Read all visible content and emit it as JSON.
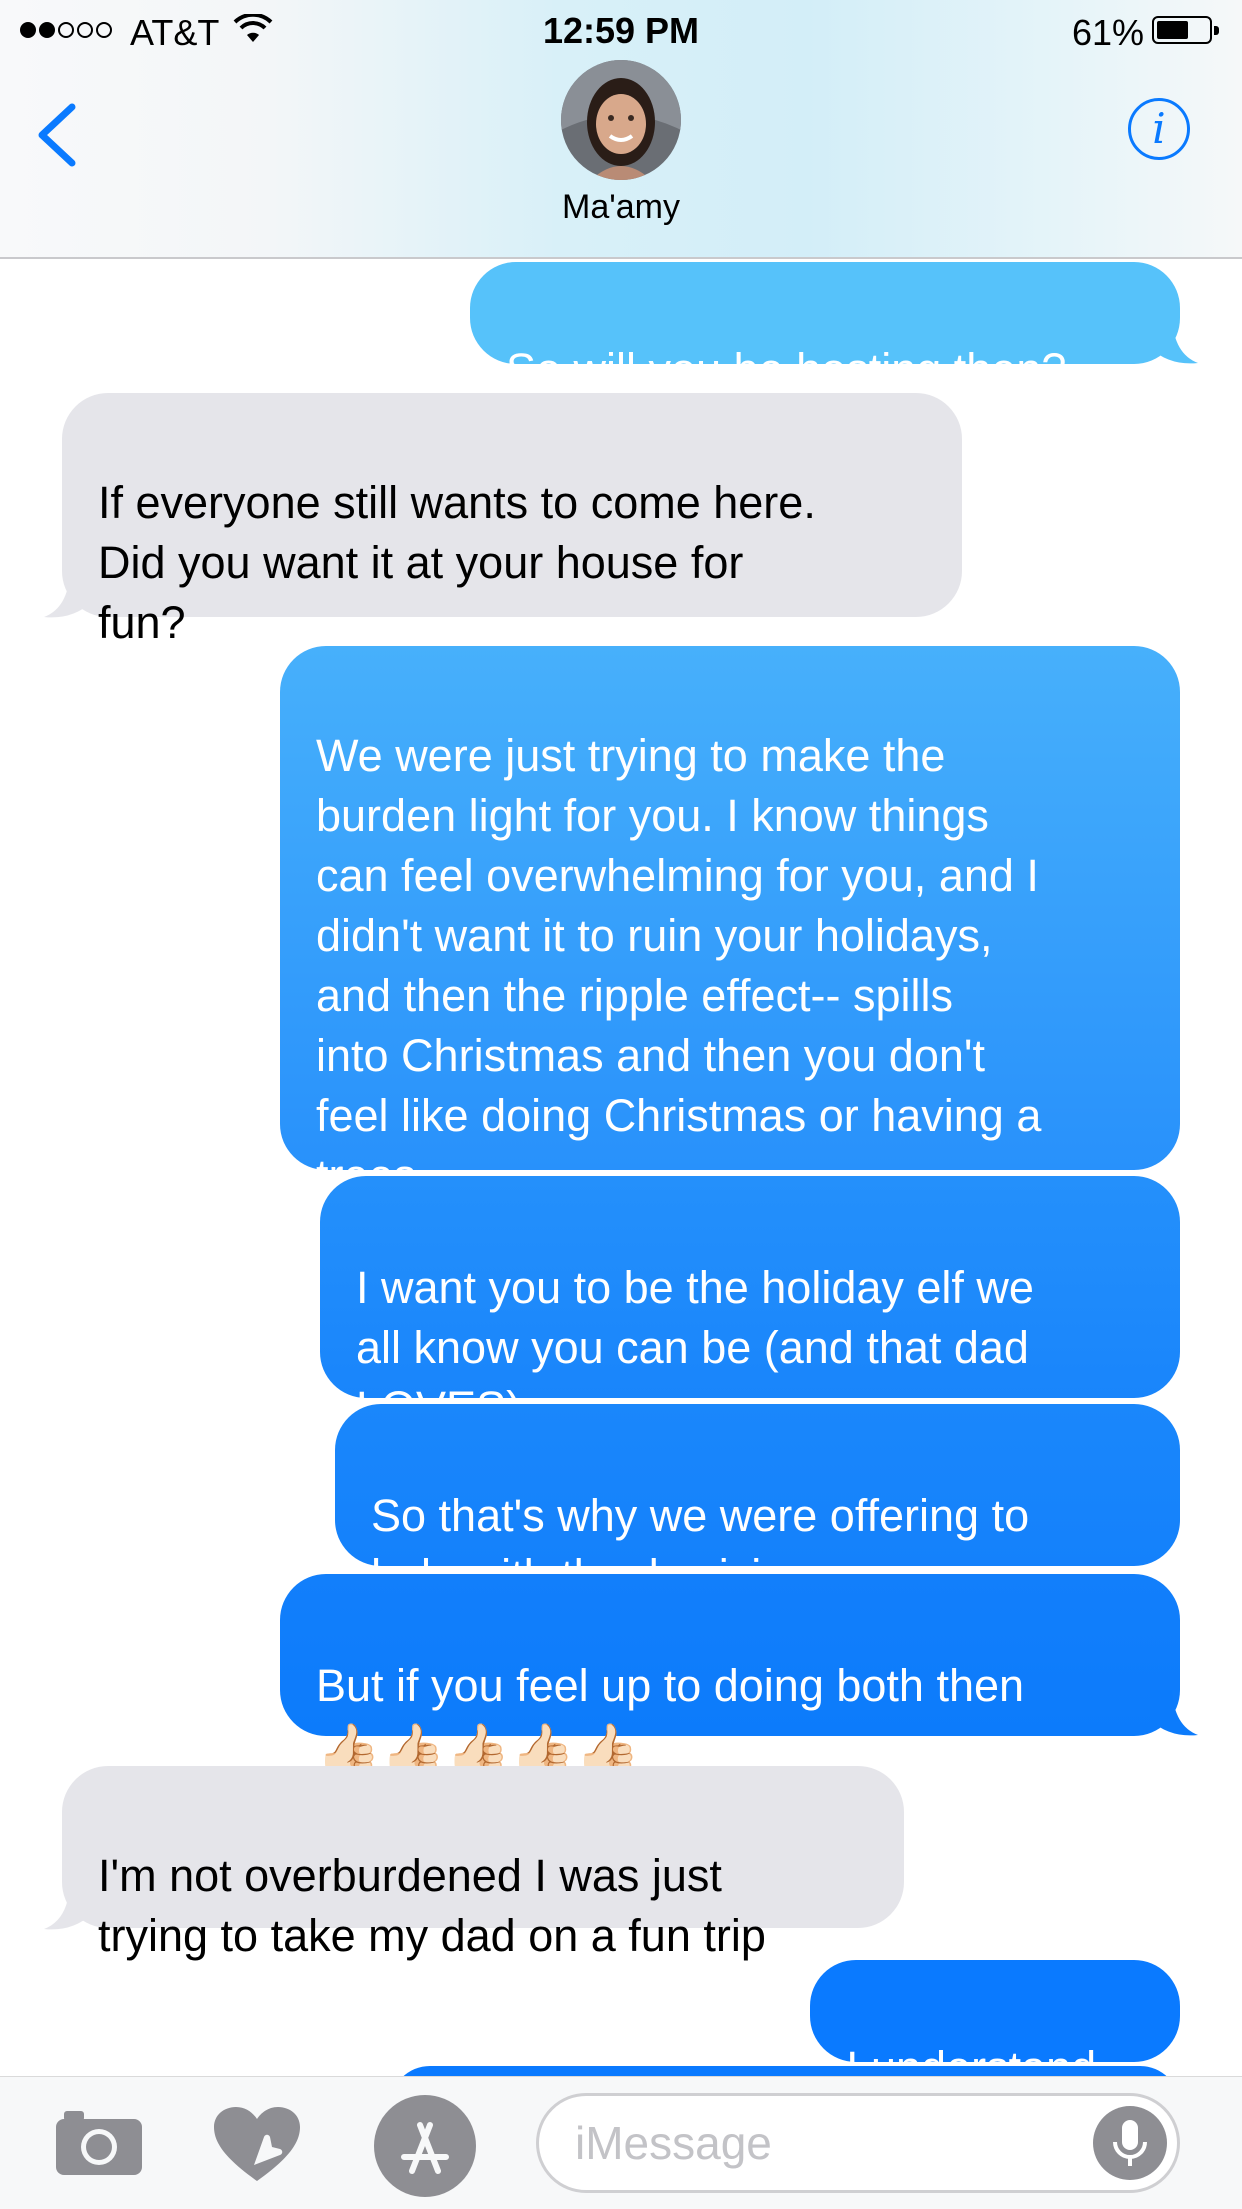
{
  "status_bar": {
    "carrier": "AT&T",
    "time": "12:59 PM",
    "battery": "61%",
    "battery_level": 0.61,
    "signal_bars_filled": 2,
    "signal_bars_total": 5
  },
  "header": {
    "contact_name": "Ma'amy",
    "info_glyph": "i"
  },
  "messages": [
    {
      "from": "me",
      "text": "So will you be hosting then?"
    },
    {
      "from": "them",
      "text": "If everyone still wants to come here.\nDid you want it at your house for\nfun?"
    },
    {
      "from": "me",
      "text": "We were just trying to make the\nburden light for you. I know things\ncan feel overwhelming for you, and I\ndidn't want it to ruin your holidays,\nand then the ripple effect-- spills\ninto Christmas and then you don't\nfeel like doing Christmas or having a\ntrees"
    },
    {
      "from": "me",
      "text": "I want you to be the holiday elf we\nall know you can be (and that dad\nLOVES)"
    },
    {
      "from": "me",
      "text": "So that's why we were offering to\nhelp with thanksgiving"
    },
    {
      "from": "me",
      "text": "But if you feel up to doing both then",
      "emoji": "👍🏻👍🏻👍🏻👍🏻👍🏻"
    },
    {
      "from": "them",
      "text": "I'm not overburdened I was just\ntrying to take my dad on a fun trip"
    },
    {
      "from": "me",
      "text": "I understand"
    }
  ],
  "input": {
    "placeholder": "iMessage"
  },
  "colors": {
    "incoming": "#e5e5ea",
    "outgoing_top": "#5ac8fa",
    "outgoing_bottom": "#0a7aff",
    "tint": "#0a7aff"
  },
  "icons": [
    "back-chevron-icon",
    "info-icon",
    "camera-icon",
    "digital-touch-icon",
    "app-store-icon",
    "microphone-icon"
  ]
}
